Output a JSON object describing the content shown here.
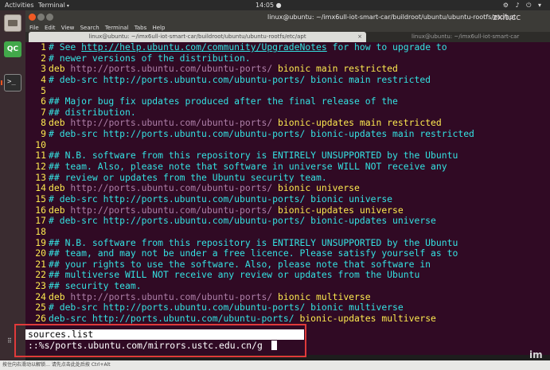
{
  "topbar": {
    "activities": "Activities",
    "app_name": "Terminal",
    "app_arrow": "▾",
    "clock": "14:05 ●",
    "tray": "⚙ ♪ ⏻ ▾"
  },
  "dock": {
    "qc_label": "QC",
    "terminal_label": ">_",
    "grid_label": "⠿"
  },
  "window": {
    "title": "linux@ubuntu: ~/imx6ull-iot-smart-car/buildroot/ubuntu/ubuntu-rootfs/etc/apt",
    "watermark": "zxit.cc"
  },
  "menu": [
    "File",
    "Edit",
    "View",
    "Search",
    "Terminal",
    "Tabs",
    "Help"
  ],
  "tabs": {
    "active": "linux@ubuntu: ~/imx6ull-iot-smart-car/buildroot/ubuntu/ubuntu-rootfs/etc/apt",
    "close": "×",
    "second": "linux@ubuntu: ~/imx6ull-iot-smart-car"
  },
  "editor": {
    "lines": [
      {
        "n": "1",
        "segs": [
          {
            "t": "# See ",
            "c": "cmt"
          },
          {
            "t": "http://help.ubuntu.com/community/UpgradeNotes",
            "c": "cmt uline"
          },
          {
            "t": " for how to upgrade to",
            "c": "cmt"
          }
        ]
      },
      {
        "n": "2",
        "segs": [
          {
            "t": "# newer versions of the distribution.",
            "c": "cmt"
          }
        ]
      },
      {
        "n": "3",
        "segs": [
          {
            "t": "deb",
            "c": "kw"
          },
          {
            "t": " http://ports.ubuntu.com/ubuntu-ports/ ",
            "c": "url"
          },
          {
            "t": "bionic main restricted",
            "c": "kw"
          }
        ]
      },
      {
        "n": "4",
        "segs": [
          {
            "t": "# deb-src http://ports.ubuntu.com/ubuntu-ports/ bionic main restricted",
            "c": "cmt"
          }
        ]
      },
      {
        "n": "5",
        "segs": []
      },
      {
        "n": "6",
        "segs": [
          {
            "t": "## Major bug fix updates produced after the final release of the",
            "c": "cmt"
          }
        ]
      },
      {
        "n": "7",
        "segs": [
          {
            "t": "## distribution.",
            "c": "cmt"
          }
        ]
      },
      {
        "n": "8",
        "segs": [
          {
            "t": "deb",
            "c": "kw"
          },
          {
            "t": " http://ports.ubuntu.com/ubuntu-ports/ ",
            "c": "url"
          },
          {
            "t": "bionic-updates main restricted",
            "c": "kw"
          }
        ]
      },
      {
        "n": "9",
        "segs": [
          {
            "t": "# deb-src http://ports.ubuntu.com/ubuntu-ports/ bionic-updates main restricted",
            "c": "cmt"
          }
        ]
      },
      {
        "n": "10",
        "segs": []
      },
      {
        "n": "11",
        "segs": [
          {
            "t": "## N.B. software from this repository is ENTIRELY UNSUPPORTED by the Ubuntu",
            "c": "cmt"
          }
        ]
      },
      {
        "n": "12",
        "segs": [
          {
            "t": "## team. Also, please note that software in universe WILL NOT receive any",
            "c": "cmt"
          }
        ]
      },
      {
        "n": "13",
        "segs": [
          {
            "t": "## review or updates from the Ubuntu security team.",
            "c": "cmt"
          }
        ]
      },
      {
        "n": "14",
        "segs": [
          {
            "t": "deb",
            "c": "kw"
          },
          {
            "t": " http://ports.ubuntu.com/ubuntu-ports/ ",
            "c": "url"
          },
          {
            "t": "bionic universe",
            "c": "kw"
          }
        ]
      },
      {
        "n": "15",
        "segs": [
          {
            "t": "# deb-src http://ports.ubuntu.com/ubuntu-ports/ bionic universe",
            "c": "cmt"
          }
        ]
      },
      {
        "n": "16",
        "segs": [
          {
            "t": "deb",
            "c": "kw"
          },
          {
            "t": " http://ports.ubuntu.com/ubuntu-ports/ ",
            "c": "url"
          },
          {
            "t": "bionic-updates universe",
            "c": "kw"
          }
        ]
      },
      {
        "n": "17",
        "segs": [
          {
            "t": "# deb-src http://ports.ubuntu.com/ubuntu-ports/ bionic-updates universe",
            "c": "cmt"
          }
        ]
      },
      {
        "n": "18",
        "segs": []
      },
      {
        "n": "19",
        "segs": [
          {
            "t": "## N.B. software from this repository is ENTIRELY UNSUPPORTED by the Ubuntu",
            "c": "cmt"
          }
        ]
      },
      {
        "n": "20",
        "segs": [
          {
            "t": "## team, and may not be under a free licence. Please satisfy yourself as to",
            "c": "cmt"
          }
        ]
      },
      {
        "n": "21",
        "segs": [
          {
            "t": "## your rights to use the software. Also, please note that software in",
            "c": "cmt"
          }
        ]
      },
      {
        "n": "22",
        "segs": [
          {
            "t": "## multiverse WILL NOT receive any review or updates from the Ubuntu",
            "c": "cmt"
          }
        ]
      },
      {
        "n": "23",
        "segs": [
          {
            "t": "## security team.",
            "c": "cmt"
          }
        ]
      },
      {
        "n": "24",
        "segs": [
          {
            "t": "deb",
            "c": "kw"
          },
          {
            "t": " http://ports.ubuntu.com/ubuntu-ports/ ",
            "c": "url"
          },
          {
            "t": "bionic multiverse",
            "c": "kw"
          }
        ]
      },
      {
        "n": "25",
        "segs": [
          {
            "t": "# deb-src http://ports.ubuntu.com/ubuntu-ports/ bionic multiverse",
            "c": "cmt"
          }
        ]
      },
      {
        "n": "26",
        "segs": [
          {
            "t": "deb-src http://ports.ubuntu.com/ubuntu-ports/ ",
            "c": "cmt"
          },
          {
            "t": "bionic-updates multiverse",
            "c": "kw"
          }
        ]
      }
    ]
  },
  "status": {
    "filename": "sources.list",
    "command": "::%s/ports.ubuntu.com/mirrors.ustc.edu.cn/g"
  },
  "bottom": {
    "status_text": "按住向右滑动以解锁…  请先点击此处后按 Ctrl+Alt",
    "brand": "im"
  }
}
